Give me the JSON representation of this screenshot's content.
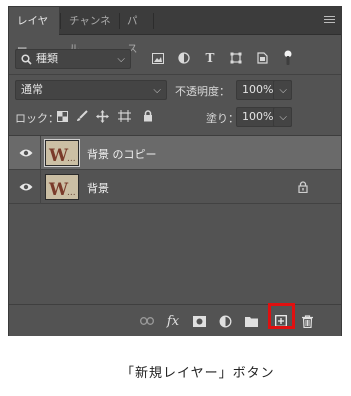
{
  "tabs": [
    {
      "label": "レイヤー",
      "active": true
    },
    {
      "label": "チャンネル",
      "active": false
    },
    {
      "label": "パス",
      "active": false
    }
  ],
  "filter": {
    "kind_label": "種類"
  },
  "blend": {
    "mode": "通常",
    "opacity_label": "不透明度：",
    "opacity_value": "100%"
  },
  "lock": {
    "label": "ロック：",
    "fill_label": "塗り：",
    "fill_value": "100%"
  },
  "layers": [
    {
      "name": "背景 のコピー",
      "visible": true,
      "selected": true,
      "locked": false
    },
    {
      "name": "背景",
      "visible": true,
      "selected": false,
      "locked": true
    }
  ],
  "footer_icons": [
    "link-icon",
    "fx-icon",
    "mask-icon",
    "adjustment-icon",
    "folder-icon",
    "new-layer-icon",
    "trash-icon"
  ],
  "caption": "「新規レイヤー」ボタン",
  "colors": {
    "panel": "#535353",
    "highlight": "#e01010",
    "selected_row": "#6a6a6a"
  }
}
